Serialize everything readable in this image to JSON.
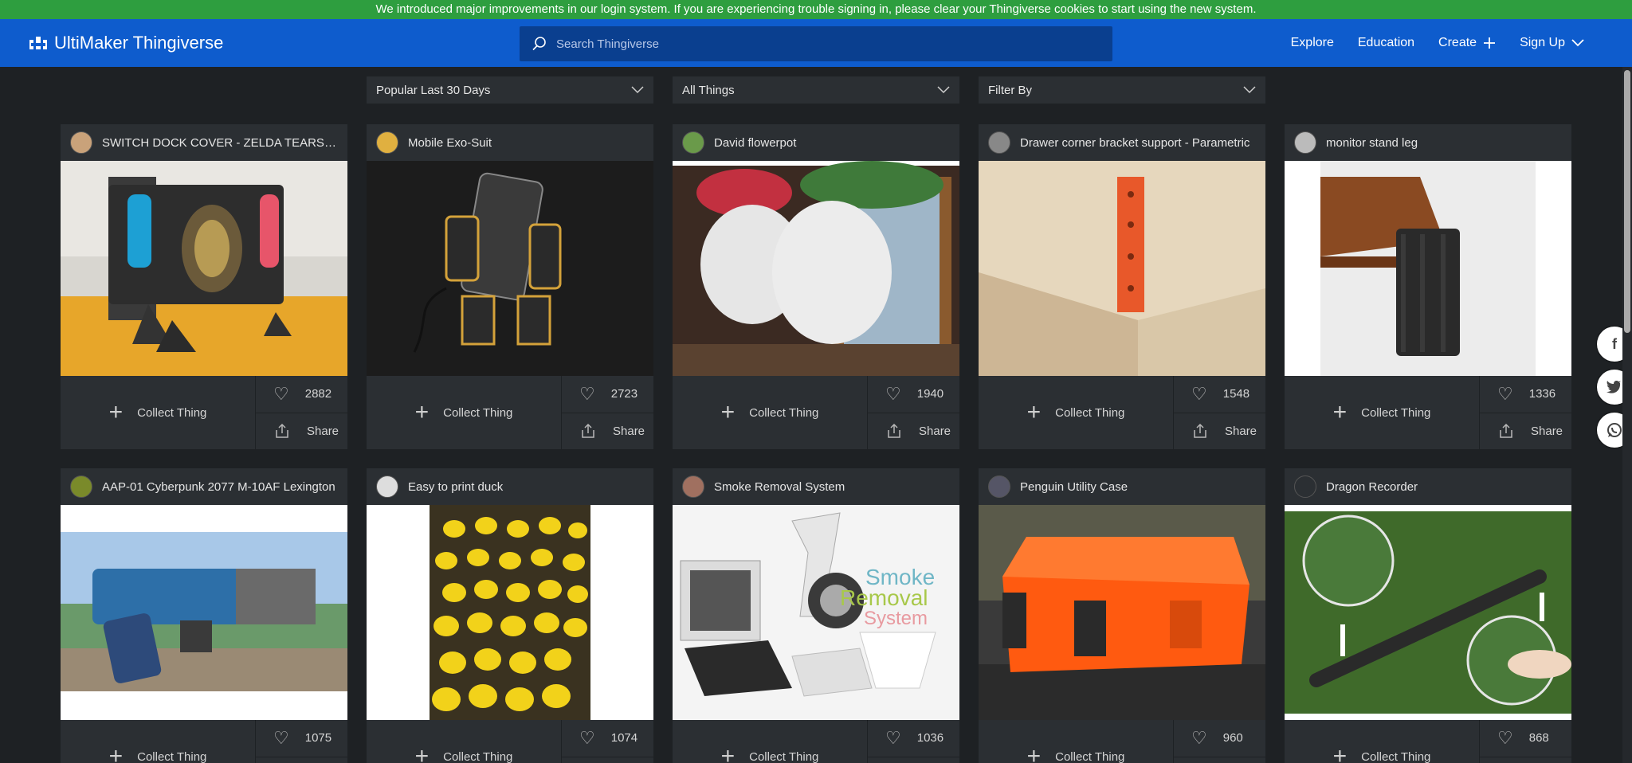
{
  "banner": {
    "text": "We introduced major improvements in our login system. If you are experiencing trouble signing in, please clear your Thingiverse cookies to start using the new system."
  },
  "header": {
    "logo": "UltiMaker Thingiverse",
    "search_placeholder": "Search Thingiverse",
    "nav": [
      {
        "label": "Explore"
      },
      {
        "label": "Education"
      },
      {
        "label": "Create"
      },
      {
        "label": "Sign Up"
      }
    ]
  },
  "filters": [
    {
      "label": "Popular Last 30 Days"
    },
    {
      "label": "All Things"
    },
    {
      "label": "Filter By"
    }
  ],
  "card_labels": {
    "collect": "Collect Thing",
    "share": "Share"
  },
  "cards": [
    {
      "title": "SWITCH DOCK COVER - ZELDA TEARS OF THE KINGDOM",
      "likes": "2882"
    },
    {
      "title": "Mobile Exo-Suit",
      "likes": "2723"
    },
    {
      "title": "David flowerpot",
      "likes": "1940"
    },
    {
      "title": "Drawer corner bracket support - Parametric",
      "likes": "1548"
    },
    {
      "title": "monitor stand leg",
      "likes": "1336"
    },
    {
      "title": "AAP-01 Cyberpunk 2077 M-10AF Lexington",
      "likes": "1075"
    },
    {
      "title": "Easy to print duck",
      "likes": "1074"
    },
    {
      "title": "Smoke Removal System",
      "likes": "1036"
    },
    {
      "title": "Penguin Utility Case",
      "likes": "960"
    },
    {
      "title": "Dragon Recorder",
      "likes": "868"
    }
  ],
  "smoke_caption": [
    "Smoke",
    "Removal",
    "System"
  ],
  "colors": {
    "banner": "#2e9e3f",
    "header": "#0e5ccd",
    "background": "#1e2124",
    "card": "#2b2f33"
  }
}
